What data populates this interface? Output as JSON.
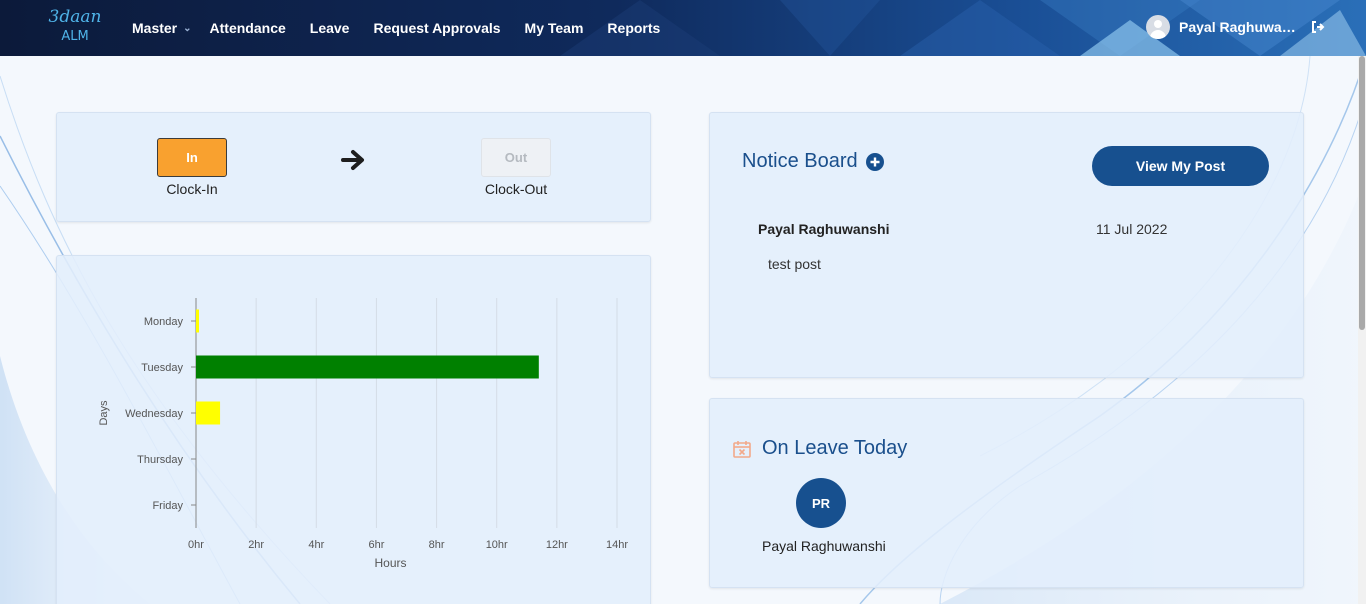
{
  "brand": {
    "logo_text": "3daan",
    "logo_sub": "ALM"
  },
  "nav": {
    "items": [
      {
        "label": "Master",
        "has_dropdown": true
      },
      {
        "label": "Attendance"
      },
      {
        "label": "Leave"
      },
      {
        "label": "Request Approvals"
      },
      {
        "label": "My Team"
      },
      {
        "label": "Reports"
      }
    ],
    "user_name": "Payal Raghuwans...",
    "logout_icon": "sign-out-icon"
  },
  "clock": {
    "in_button": "In",
    "in_label": "Clock-In",
    "out_button": "Out",
    "out_label": "Clock-Out",
    "in_color": "#f9a12f",
    "arrow_icon": "arrow-right-icon"
  },
  "chart_data": {
    "type": "bar",
    "orientation": "horizontal",
    "categories": [
      "Monday",
      "Tuesday",
      "Wednesday",
      "Thursday",
      "Friday"
    ],
    "values": [
      0.1,
      11.4,
      0.8,
      0,
      0
    ],
    "colors": [
      "#ffff00",
      "#008000",
      "#ffff00",
      "#ffff00",
      "#ffff00"
    ],
    "xlabel": "Hours",
    "ylabel": "Days",
    "xlim": [
      0,
      14
    ],
    "x_ticks": [
      "0hr",
      "2hr",
      "4hr",
      "6hr",
      "8hr",
      "10hr",
      "12hr",
      "14hr"
    ],
    "grid": true
  },
  "notice": {
    "title": "Notice Board",
    "add_icon": "plus-circle-icon",
    "view_button": "View My Post",
    "posts": [
      {
        "author": "Payal Raghuwanshi",
        "date": "11 Jul 2022",
        "text": "test post"
      }
    ]
  },
  "on_leave": {
    "title": "On Leave Today",
    "icon": "calendar-x-icon",
    "people": [
      {
        "initials": "PR",
        "name": "Payal Raghuwanshi"
      }
    ]
  },
  "colors": {
    "primary": "#17508f",
    "title": "#1a4f8c",
    "card_bg": "#e2eefc"
  }
}
